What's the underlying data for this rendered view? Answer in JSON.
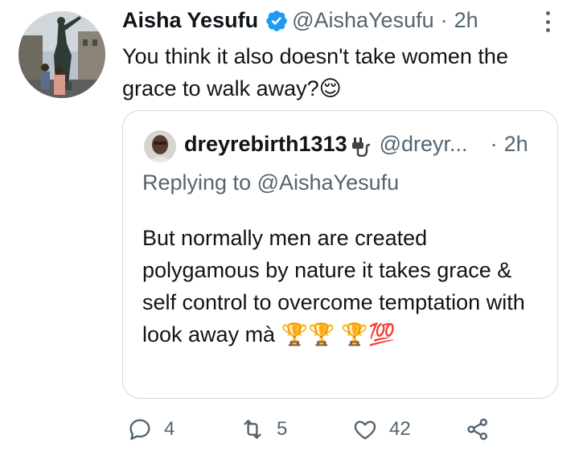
{
  "tweet": {
    "author_name": "Aisha Yesufu",
    "handle": "@AishaYesufu",
    "separator": "·",
    "time": "2h",
    "text": "You think it also doesn't take women the grace to walk away?",
    "emoji": "😌"
  },
  "quote": {
    "author_name": "dreyrebirth1313",
    "handle": "@dreyr...",
    "separator": "·",
    "time": "2h",
    "replying_prefix": "Replying to",
    "replying_handle": "@AishaYesufu",
    "text": "But normally men are created polygamous by nature it takes grace & self control to overcome temptation with look away mà",
    "trailing_emoji": "🏆🏆 🏆💯"
  },
  "actions": {
    "replies": "4",
    "retweets": "5",
    "likes": "42"
  },
  "colors": {
    "text": "#0f1419",
    "secondary": "#536471",
    "verified": "#1d9bf0",
    "border": "#cfd9de"
  }
}
